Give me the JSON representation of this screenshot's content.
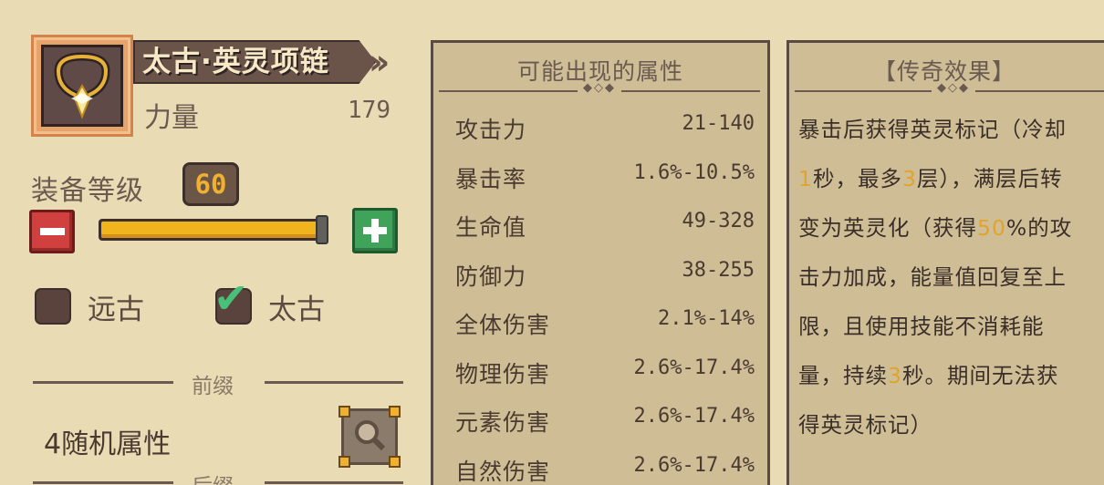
{
  "item": {
    "name": "太古·英灵项链",
    "icon": "necklace-icon",
    "stat_label": "力量",
    "stat_value": "179"
  },
  "level": {
    "label": "装备等级",
    "value": "60",
    "progress": 1.0
  },
  "tiers": [
    {
      "label": "远古",
      "checked": false
    },
    {
      "label": "太古",
      "checked": true
    }
  ],
  "prefix": {
    "label": "前缀",
    "value": "4随机属性"
  },
  "suffix_label": "后缀",
  "attributes": {
    "title": "可能出现的属性",
    "rows": [
      {
        "name": "攻击力",
        "value": "21-140"
      },
      {
        "name": "暴击率",
        "value": "1.6%-10.5%"
      },
      {
        "name": "生命值",
        "value": "49-328"
      },
      {
        "name": "防御力",
        "value": "38-255"
      },
      {
        "name": "全体伤害",
        "value": "2.1%-14%"
      },
      {
        "name": "物理伤害",
        "value": "2.6%-17.4%"
      },
      {
        "name": "元素伤害",
        "value": "2.6%-17.4%"
      },
      {
        "name": "自然伤害",
        "value": "2.6%-17.4%"
      }
    ]
  },
  "legend": {
    "title": "【传奇效果】",
    "lines": [
      [
        "暴击后获得英灵标记（冷却"
      ],
      [
        "1",
        "秒，最多",
        "3",
        "层），满层后转"
      ],
      [
        "变为英灵化（获得",
        "50",
        "%的攻"
      ],
      [
        "击力加成，能量值回复至上"
      ],
      [
        "限，且使用技能不消耗能"
      ],
      [
        "量，持续",
        "3",
        "秒。期间无法获"
      ],
      [
        "得英灵标记）"
      ]
    ]
  },
  "colors": {
    "background": "#e9dcb4",
    "panel": "#cfbd96",
    "highlight": "#e2a32a",
    "level_badge_text": "#f0b030",
    "minus_button": "#d0403e",
    "plus_button": "#3fa45a"
  }
}
